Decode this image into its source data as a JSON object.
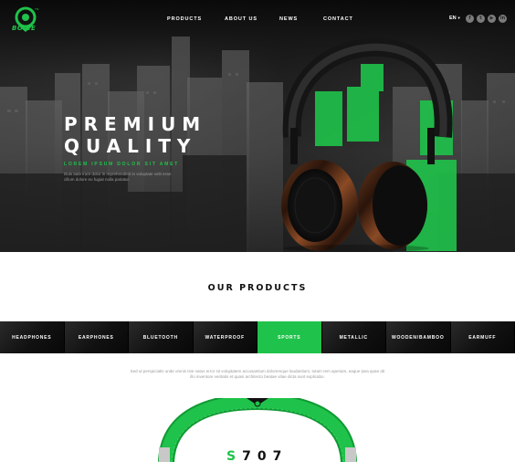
{
  "brand": {
    "name": "BOICE",
    "tm": "TM"
  },
  "nav": {
    "links": [
      "PRODUCTS",
      "ABOUT US",
      "NEWS",
      "CONTACT"
    ],
    "language": "EN",
    "social": [
      {
        "icon": "facebook-icon",
        "glyph": "f"
      },
      {
        "icon": "twitter-icon",
        "glyph": "t"
      },
      {
        "icon": "youtube-icon",
        "glyph": "▶"
      },
      {
        "icon": "linkedin-icon",
        "glyph": "in"
      }
    ]
  },
  "hero": {
    "title_line1": "PREMIUM",
    "title_line2": "QUALITY",
    "subtitle": "LOREM IPSUM DOLOR SIT AMET",
    "description": "Duis aute irure dolor in reprehenderit in voluptate velit esse cillum dolore eu fugiat nulla pariatur."
  },
  "products": {
    "title": "OUR PRODUCTS",
    "categories": [
      "HEADPHONES",
      "EARPHONES",
      "BLUETOOTH",
      "WATERPROOF",
      "SPORTS",
      "METALLIC",
      "WOODEN/BAMBOO",
      "EARMUFF"
    ],
    "active_category": "SPORTS",
    "description": "Sed ut perspiciatis unde omnis iste natus error sit voluptatem accusantium doloremque laudantium, totam rem aperiam, eaque ipsa quae ab illo inventore veritatis et quasi architecto beatae vitae dicta sunt explicabo.",
    "model_first": "S",
    "model_rest": "707"
  },
  "colors": {
    "accent": "#1fc24a",
    "dark": "#111111"
  }
}
